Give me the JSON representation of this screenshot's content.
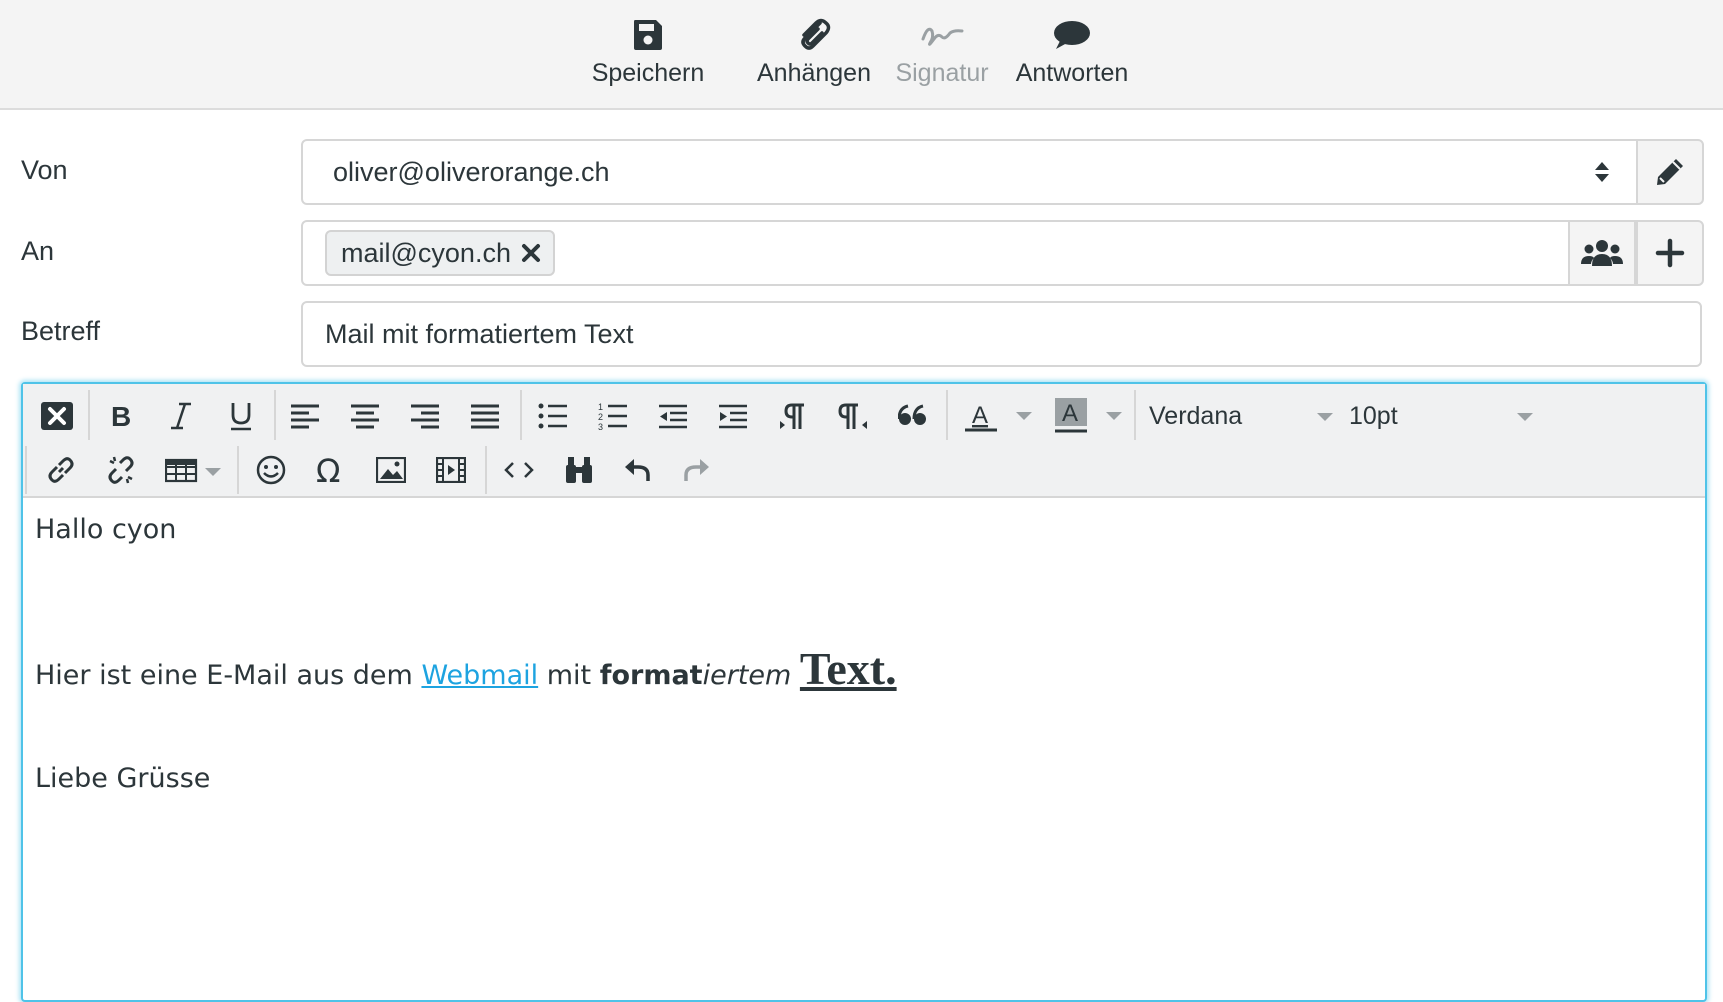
{
  "toolbar": {
    "save_label": "Speichern",
    "attach_label": "Anhängen",
    "signature_label": "Signatur",
    "reply_label": "Antworten"
  },
  "form": {
    "from_label": "Von",
    "from_value": "oliver@oliverorange.ch",
    "to_label": "An",
    "to_recipient": "mail@cyon.ch",
    "subject_label": "Betreff",
    "subject_value": "Mail mit formatiertem Text"
  },
  "editor": {
    "font_family": "Verdana",
    "font_size": "10pt",
    "body": {
      "greeting": "Hallo cyon",
      "line_prefix": "Hier ist eine E-Mail aus dem ",
      "link_text": "Webmail",
      "mid_text": " mit ",
      "bold_part": "format",
      "italic_part": "iertem",
      "big_part": "Text.",
      "closing": "Liebe Grüsse"
    }
  },
  "colors": {
    "accent": "#4fc3e8",
    "link": "#1da3e0",
    "text": "#2c363a",
    "disabled": "#9aa0a3"
  },
  "icons": {
    "save": "floppy-disk-icon",
    "attach": "paperclip-icon",
    "signature": "signature-icon",
    "reply": "speech-bubble-icon"
  }
}
